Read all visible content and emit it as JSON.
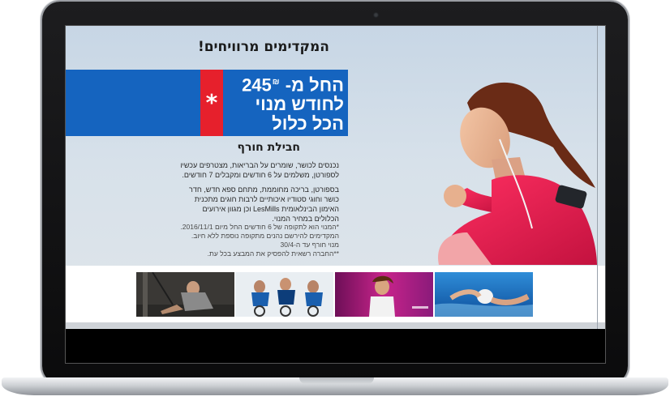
{
  "page": {
    "headline": "המקדימים מרוויחים!",
    "promo": {
      "line1_prefix": "החל מ- 245",
      "currency": "₪",
      "line2": "לחודש מנוי",
      "line3": "הכל כלול",
      "asterisk": "*"
    },
    "subhead": "חבילת חורף",
    "paragraph1": [
      "נכנסים לכושר, שומרים על הבריאות, מצטרפים עכשיו",
      "לספורטן, משלמים על 6 חודשים ומקבלים 7 חודשים."
    ],
    "paragraph2": [
      "בספורטן, בריכה מחוממת, מתחם ספא חדש, חדר",
      "כושר וחוגי סטודיו איכותיים לרבות חוגים מתכנית",
      "האימון הבינלאומית LesMills וכן מגוון אירועים",
      "הכלולים במחיר המנוי."
    ],
    "footnotes": [
      "*המנוי הוא לתקופה של 6 חודשים החל מיום 2016/11/1.",
      "המקדימים להירשם נהנים מתקופה נוספת ללא חיוב.",
      "מנוי חורף עד ה-30/4",
      "**החברה רשאית להפסיק את המבצע בכל עת."
    ],
    "thumbnails": [
      "trx-training",
      "spinning-class",
      "dance-fitness",
      "swimming"
    ]
  },
  "colors": {
    "promo_blue": "#1564bf",
    "promo_red": "#e6202c",
    "jacket_pink": "#e8204f"
  }
}
